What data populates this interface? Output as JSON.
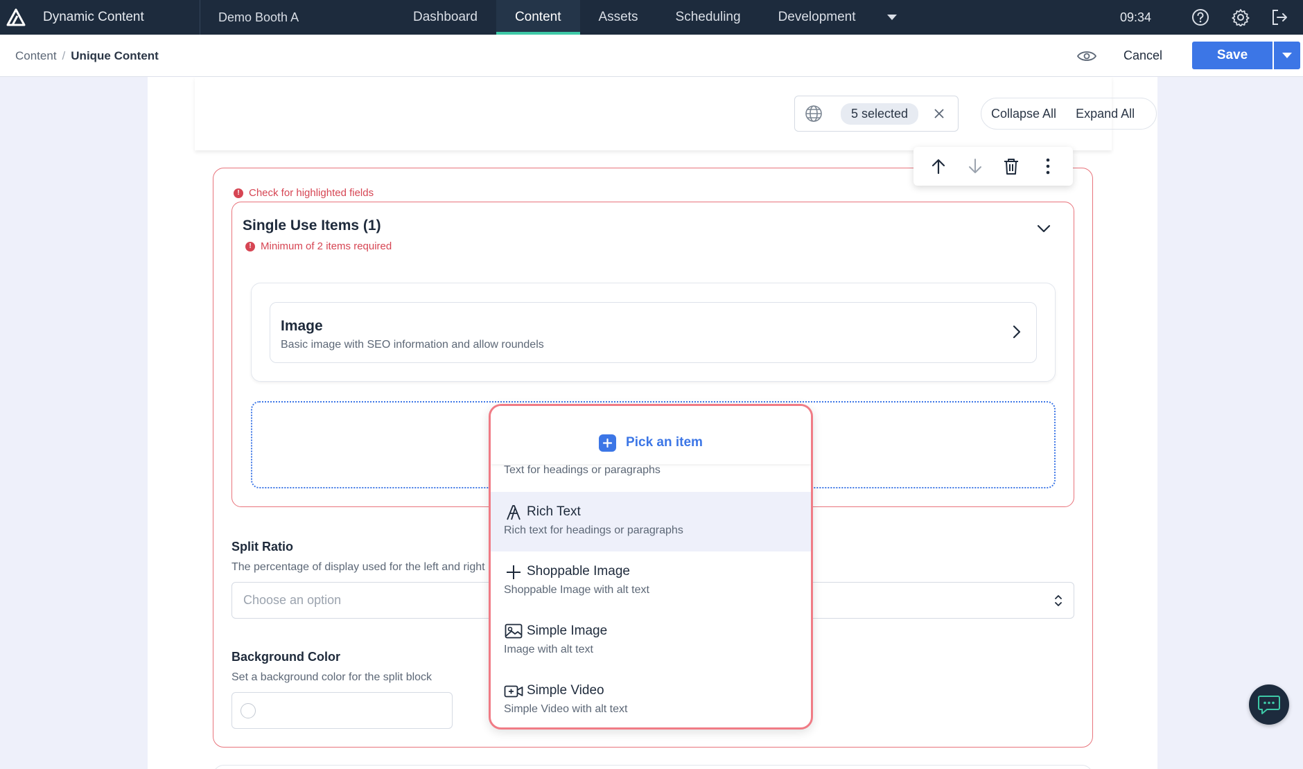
{
  "topbar": {
    "app_name": "Dynamic Content",
    "hub_name": "Demo Booth A",
    "tabs": [
      {
        "label": "Dashboard"
      },
      {
        "label": "Content"
      },
      {
        "label": "Assets"
      },
      {
        "label": "Scheduling"
      },
      {
        "label": "Development"
      }
    ],
    "active_tab": "Content",
    "time": "09:34"
  },
  "subbar": {
    "breadcrumb": {
      "root": "Content",
      "current": "Unique Content"
    },
    "cancel_label": "Cancel",
    "save_label": "Save"
  },
  "locale": {
    "selected_label": "5 selected"
  },
  "view_controls": {
    "collapse_all": "Collapse All",
    "expand_all": "Expand All"
  },
  "block": {
    "error_message": "Check for highlighted fields",
    "items": {
      "title": "Single Use Items (1)",
      "error": "Minimum of 2 items required",
      "card": {
        "title": "Image",
        "description": "Basic image with SEO information and allow roundels"
      }
    },
    "split_ratio": {
      "label": "Split Ratio",
      "help": "The percentage of display used for the left and right",
      "placeholder": "Choose an option"
    },
    "background_color": {
      "label": "Background Color",
      "help": "Set a background color for the split block"
    }
  },
  "picker": {
    "title": "Pick an item",
    "options": [
      {
        "name": "",
        "description": "Text for headings or paragraphs",
        "icon": "text-icon"
      },
      {
        "name": "Rich Text",
        "description": "Rich text for headings or paragraphs",
        "icon": "rich-text-icon"
      },
      {
        "name": "Shoppable Image",
        "description": "Shoppable Image with alt text",
        "icon": "plus-icon"
      },
      {
        "name": "Simple Image",
        "description": "Image with alt text",
        "icon": "image-icon"
      },
      {
        "name": "Simple Video",
        "description": "Simple Video with alt text",
        "icon": "video-icon"
      }
    ]
  },
  "colors": {
    "nav_bg": "#1d2b3d",
    "active_tab_underline": "#3ec9a7",
    "primary": "#3c76e6",
    "error": "#d64553"
  }
}
